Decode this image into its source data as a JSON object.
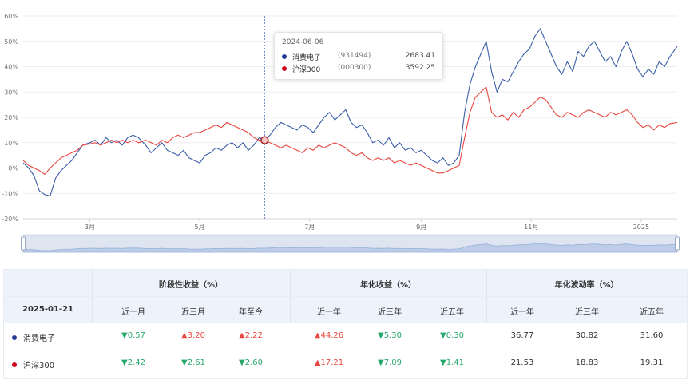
{
  "chart_data": {
    "type": "line",
    "ylim": [
      -20,
      60
    ],
    "yticks": [
      -20,
      -10,
      0,
      10,
      20,
      30,
      40,
      50,
      60
    ],
    "ytick_labels": [
      "-20%",
      "-10%",
      "0%",
      "10%",
      "20%",
      "30%",
      "40%",
      "50%",
      "60%"
    ],
    "xlim": [
      "2024-01-24",
      "2025-01-21"
    ],
    "xticks": [
      {
        "date": "2024-03-01",
        "label": "3月"
      },
      {
        "date": "2024-05-01",
        "label": "5月"
      },
      {
        "date": "2024-07-01",
        "label": "7月"
      },
      {
        "date": "2024-09-01",
        "label": "9月"
      },
      {
        "date": "2024-11-01",
        "label": "11月"
      },
      {
        "date": "2025-01-01",
        "label": "2025"
      }
    ],
    "crosshair_date": "2024-06-06",
    "series": [
      {
        "name": "消费电子",
        "color": "#3a5ea8",
        "points": [
          [
            "2024-01-24",
            2
          ],
          [
            "2024-01-27",
            0
          ],
          [
            "2024-01-30",
            -3
          ],
          [
            "2024-02-02",
            -9
          ],
          [
            "2024-02-05",
            -10.5
          ],
          [
            "2024-02-08",
            -11
          ],
          [
            "2024-02-11",
            -4
          ],
          [
            "2024-02-14",
            -1
          ],
          [
            "2024-02-17",
            1
          ],
          [
            "2024-02-20",
            3
          ],
          [
            "2024-02-23",
            6
          ],
          [
            "2024-02-26",
            9
          ],
          [
            "2024-03-01",
            10
          ],
          [
            "2024-03-04",
            11
          ],
          [
            "2024-03-07",
            9
          ],
          [
            "2024-03-10",
            12
          ],
          [
            "2024-03-13",
            10
          ],
          [
            "2024-03-16",
            11
          ],
          [
            "2024-03-19",
            9
          ],
          [
            "2024-03-22",
            12
          ],
          [
            "2024-03-25",
            13
          ],
          [
            "2024-03-28",
            12
          ],
          [
            "2024-04-01",
            9
          ],
          [
            "2024-04-04",
            6
          ],
          [
            "2024-04-07",
            8
          ],
          [
            "2024-04-10",
            10
          ],
          [
            "2024-04-13",
            7
          ],
          [
            "2024-04-16",
            6
          ],
          [
            "2024-04-19",
            5
          ],
          [
            "2024-04-22",
            7
          ],
          [
            "2024-04-25",
            4
          ],
          [
            "2024-04-28",
            3
          ],
          [
            "2024-05-01",
            2
          ],
          [
            "2024-05-04",
            5
          ],
          [
            "2024-05-07",
            6
          ],
          [
            "2024-05-10",
            8
          ],
          [
            "2024-05-13",
            7
          ],
          [
            "2024-05-16",
            9
          ],
          [
            "2024-05-19",
            10
          ],
          [
            "2024-05-22",
            8
          ],
          [
            "2024-05-25",
            10
          ],
          [
            "2024-05-28",
            7
          ],
          [
            "2024-05-31",
            9
          ],
          [
            "2024-06-03",
            12
          ],
          [
            "2024-06-06",
            11
          ],
          [
            "2024-06-09",
            13
          ],
          [
            "2024-06-12",
            16
          ],
          [
            "2024-06-15",
            18
          ],
          [
            "2024-06-18",
            17
          ],
          [
            "2024-06-21",
            16
          ],
          [
            "2024-06-24",
            15
          ],
          [
            "2024-06-27",
            17
          ],
          [
            "2024-06-30",
            16
          ],
          [
            "2024-07-03",
            14
          ],
          [
            "2024-07-06",
            17
          ],
          [
            "2024-07-09",
            20
          ],
          [
            "2024-07-12",
            22
          ],
          [
            "2024-07-15",
            19
          ],
          [
            "2024-07-18",
            21
          ],
          [
            "2024-07-21",
            23
          ],
          [
            "2024-07-24",
            18
          ],
          [
            "2024-07-27",
            16
          ],
          [
            "2024-07-30",
            17
          ],
          [
            "2024-08-02",
            14
          ],
          [
            "2024-08-05",
            10
          ],
          [
            "2024-08-08",
            11
          ],
          [
            "2024-08-11",
            9
          ],
          [
            "2024-08-14",
            12
          ],
          [
            "2024-08-17",
            8
          ],
          [
            "2024-08-20",
            10
          ],
          [
            "2024-08-23",
            7
          ],
          [
            "2024-08-26",
            8
          ],
          [
            "2024-08-29",
            6
          ],
          [
            "2024-09-01",
            7
          ],
          [
            "2024-09-04",
            5
          ],
          [
            "2024-09-07",
            3
          ],
          [
            "2024-09-10",
            2
          ],
          [
            "2024-09-13",
            4
          ],
          [
            "2024-09-16",
            1
          ],
          [
            "2024-09-19",
            2
          ],
          [
            "2024-09-22",
            5
          ],
          [
            "2024-09-25",
            22
          ],
          [
            "2024-09-28",
            33
          ],
          [
            "2024-10-01",
            40
          ],
          [
            "2024-10-04",
            45
          ],
          [
            "2024-10-07",
            50
          ],
          [
            "2024-10-10",
            38
          ],
          [
            "2024-10-13",
            30
          ],
          [
            "2024-10-16",
            35
          ],
          [
            "2024-10-19",
            34
          ],
          [
            "2024-10-22",
            38
          ],
          [
            "2024-10-25",
            42
          ],
          [
            "2024-10-28",
            45
          ],
          [
            "2024-10-31",
            47
          ],
          [
            "2024-11-03",
            52
          ],
          [
            "2024-11-06",
            55
          ],
          [
            "2024-11-09",
            50
          ],
          [
            "2024-11-12",
            45
          ],
          [
            "2024-11-15",
            40
          ],
          [
            "2024-11-18",
            37
          ],
          [
            "2024-11-21",
            42
          ],
          [
            "2024-11-24",
            38
          ],
          [
            "2024-11-27",
            46
          ],
          [
            "2024-11-30",
            44
          ],
          [
            "2024-12-03",
            48
          ],
          [
            "2024-12-06",
            50
          ],
          [
            "2024-12-09",
            46
          ],
          [
            "2024-12-12",
            42
          ],
          [
            "2024-12-15",
            44
          ],
          [
            "2024-12-18",
            40
          ],
          [
            "2024-12-21",
            46
          ],
          [
            "2024-12-24",
            50
          ],
          [
            "2024-12-27",
            45
          ],
          [
            "2024-12-30",
            39
          ],
          [
            "2025-01-02",
            36
          ],
          [
            "2025-01-05",
            39
          ],
          [
            "2025-01-08",
            37
          ],
          [
            "2025-01-11",
            42
          ],
          [
            "2025-01-14",
            40
          ],
          [
            "2025-01-17",
            44
          ],
          [
            "2025-01-21",
            48
          ]
        ]
      },
      {
        "name": "沪深300",
        "color": "#e8463e",
        "points": [
          [
            "2024-01-24",
            3
          ],
          [
            "2024-01-27",
            1
          ],
          [
            "2024-01-30",
            0
          ],
          [
            "2024-02-02",
            -1
          ],
          [
            "2024-02-05",
            -2.5
          ],
          [
            "2024-02-08",
            0
          ],
          [
            "2024-02-11",
            2
          ],
          [
            "2024-02-14",
            4
          ],
          [
            "2024-02-17",
            5
          ],
          [
            "2024-02-20",
            6
          ],
          [
            "2024-02-23",
            7
          ],
          [
            "2024-02-26",
            9
          ],
          [
            "2024-03-01",
            9.5
          ],
          [
            "2024-03-04",
            10
          ],
          [
            "2024-03-07",
            9
          ],
          [
            "2024-03-10",
            10
          ],
          [
            "2024-03-13",
            11
          ],
          [
            "2024-03-16",
            10
          ],
          [
            "2024-03-19",
            11
          ],
          [
            "2024-03-22",
            10
          ],
          [
            "2024-03-25",
            11
          ],
          [
            "2024-03-28",
            10
          ],
          [
            "2024-04-01",
            11
          ],
          [
            "2024-04-04",
            10
          ],
          [
            "2024-04-07",
            9
          ],
          [
            "2024-04-10",
            11
          ],
          [
            "2024-04-13",
            10
          ],
          [
            "2024-04-16",
            12
          ],
          [
            "2024-04-19",
            13
          ],
          [
            "2024-04-22",
            12
          ],
          [
            "2024-04-25",
            13
          ],
          [
            "2024-04-28",
            14
          ],
          [
            "2024-05-01",
            14
          ],
          [
            "2024-05-04",
            15
          ],
          [
            "2024-05-07",
            16
          ],
          [
            "2024-05-10",
            17
          ],
          [
            "2024-05-13",
            16
          ],
          [
            "2024-05-16",
            18
          ],
          [
            "2024-05-19",
            17
          ],
          [
            "2024-05-22",
            16
          ],
          [
            "2024-05-25",
            15
          ],
          [
            "2024-05-28",
            14
          ],
          [
            "2024-05-31",
            12
          ],
          [
            "2024-06-03",
            11
          ],
          [
            "2024-06-06",
            11
          ],
          [
            "2024-06-09",
            10
          ],
          [
            "2024-06-12",
            9
          ],
          [
            "2024-06-15",
            8
          ],
          [
            "2024-06-18",
            9
          ],
          [
            "2024-06-21",
            8
          ],
          [
            "2024-06-24",
            7
          ],
          [
            "2024-06-27",
            6
          ],
          [
            "2024-06-30",
            8
          ],
          [
            "2024-07-03",
            7
          ],
          [
            "2024-07-06",
            9
          ],
          [
            "2024-07-09",
            8
          ],
          [
            "2024-07-12",
            9
          ],
          [
            "2024-07-15",
            10
          ],
          [
            "2024-07-18",
            9
          ],
          [
            "2024-07-21",
            8
          ],
          [
            "2024-07-24",
            6
          ],
          [
            "2024-07-27",
            5
          ],
          [
            "2024-07-30",
            6
          ],
          [
            "2024-08-02",
            4
          ],
          [
            "2024-08-05",
            3
          ],
          [
            "2024-08-08",
            4
          ],
          [
            "2024-08-11",
            3
          ],
          [
            "2024-08-14",
            4
          ],
          [
            "2024-08-17",
            2
          ],
          [
            "2024-08-20",
            3
          ],
          [
            "2024-08-23",
            2
          ],
          [
            "2024-08-26",
            1
          ],
          [
            "2024-08-29",
            2
          ],
          [
            "2024-09-01",
            1
          ],
          [
            "2024-09-04",
            0
          ],
          [
            "2024-09-07",
            -1
          ],
          [
            "2024-09-10",
            -2
          ],
          [
            "2024-09-13",
            -2
          ],
          [
            "2024-09-16",
            -1
          ],
          [
            "2024-09-19",
            0
          ],
          [
            "2024-09-22",
            1
          ],
          [
            "2024-09-25",
            12
          ],
          [
            "2024-09-28",
            22
          ],
          [
            "2024-10-01",
            28
          ],
          [
            "2024-10-04",
            30
          ],
          [
            "2024-10-07",
            32
          ],
          [
            "2024-10-10",
            22
          ],
          [
            "2024-10-13",
            20
          ],
          [
            "2024-10-16",
            21
          ],
          [
            "2024-10-19",
            19
          ],
          [
            "2024-10-22",
            22
          ],
          [
            "2024-10-25",
            20
          ],
          [
            "2024-10-28",
            23
          ],
          [
            "2024-10-31",
            24
          ],
          [
            "2024-11-03",
            26
          ],
          [
            "2024-11-06",
            28
          ],
          [
            "2024-11-09",
            27
          ],
          [
            "2024-11-12",
            24
          ],
          [
            "2024-11-15",
            21
          ],
          [
            "2024-11-18",
            20
          ],
          [
            "2024-11-21",
            22
          ],
          [
            "2024-11-24",
            21
          ],
          [
            "2024-11-27",
            20
          ],
          [
            "2024-11-30",
            22
          ],
          [
            "2024-12-03",
            23
          ],
          [
            "2024-12-06",
            22
          ],
          [
            "2024-12-09",
            21
          ],
          [
            "2024-12-12",
            20
          ],
          [
            "2024-12-15",
            22
          ],
          [
            "2024-12-18",
            21
          ],
          [
            "2024-12-21",
            22
          ],
          [
            "2024-12-24",
            23
          ],
          [
            "2024-12-27",
            21
          ],
          [
            "2024-12-30",
            18
          ],
          [
            "2025-01-02",
            16
          ],
          [
            "2025-01-05",
            17
          ],
          [
            "2025-01-08",
            15
          ],
          [
            "2025-01-11",
            17
          ],
          [
            "2025-01-14",
            16
          ],
          [
            "2025-01-17",
            17.5
          ],
          [
            "2025-01-21",
            18
          ]
        ]
      }
    ]
  },
  "tooltip": {
    "date": "2024-06-06",
    "rows": [
      {
        "name": "消费电子",
        "code": "(931494)",
        "value": "2683.41",
        "color": "#1f3a93"
      },
      {
        "name": "沪深300",
        "code": "(000300)",
        "value": "3592.25",
        "color": "#d0021b"
      }
    ]
  },
  "table": {
    "date_label": "2025-01-21",
    "groups": [
      "阶段性收益（%）",
      "年化收益（%）",
      "年化波动率（%）"
    ],
    "subheaders": [
      "近一月",
      "近三月",
      "年至今",
      "近一年",
      "近三年",
      "近五年",
      "近一年",
      "近三年",
      "近五年"
    ],
    "rows": [
      {
        "name": "消费电子",
        "color": "#1f3a93",
        "cells": [
          {
            "text": "▼0.57",
            "dir": "down"
          },
          {
            "text": "▲3.20",
            "dir": "up"
          },
          {
            "text": "▲2.22",
            "dir": "up"
          },
          {
            "text": "▲44.26",
            "dir": "up"
          },
          {
            "text": "▼5.30",
            "dir": "down"
          },
          {
            "text": "▼0.30",
            "dir": "down"
          },
          {
            "text": "36.77",
            "dir": "neu"
          },
          {
            "text": "30.82",
            "dir": "neu"
          },
          {
            "text": "31.60",
            "dir": "neu"
          }
        ]
      },
      {
        "name": "沪深300",
        "color": "#d0021b",
        "cells": [
          {
            "text": "▼2.42",
            "dir": "down"
          },
          {
            "text": "▼2.61",
            "dir": "down"
          },
          {
            "text": "▼2.60",
            "dir": "down"
          },
          {
            "text": "▲17.21",
            "dir": "up"
          },
          {
            "text": "▼7.09",
            "dir": "down"
          },
          {
            "text": "▼1.41",
            "dir": "down"
          },
          {
            "text": "21.53",
            "dir": "neu"
          },
          {
            "text": "18.83",
            "dir": "neu"
          },
          {
            "text": "19.31",
            "dir": "neu"
          }
        ]
      }
    ]
  }
}
